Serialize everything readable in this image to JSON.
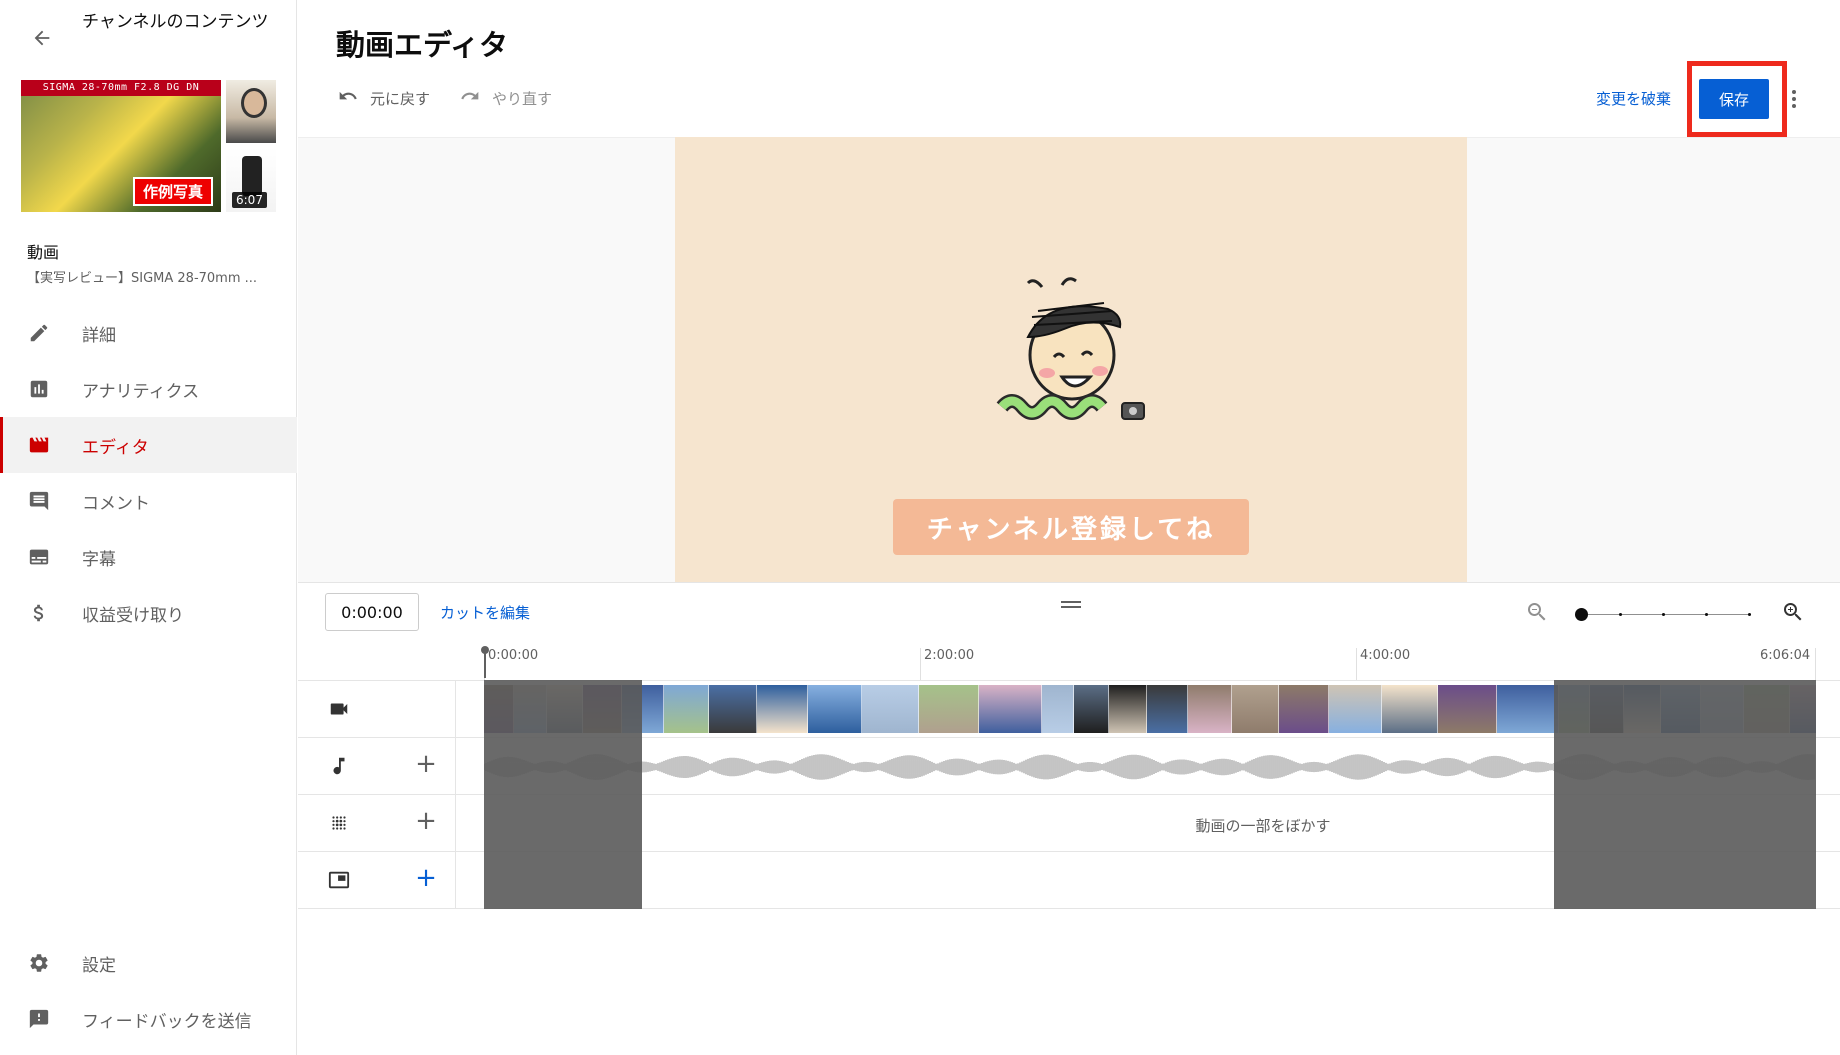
{
  "sidebar": {
    "back_label": "チャンネルのコンテンツ",
    "thumbnail": {
      "banner_text": "SIGMA 28-70mm F2.8 DG DN",
      "tag_text": "作例写真",
      "duration": "6:07"
    },
    "video_label": "動画",
    "video_title": "【実写レビュー】SIGMA 28-70mm ...",
    "nav_items": [
      {
        "label": "詳細",
        "icon": "pencil-icon"
      },
      {
        "label": "アナリティクス",
        "icon": "analytics-icon"
      },
      {
        "label": "エディタ",
        "icon": "clapperboard-icon",
        "active": true
      },
      {
        "label": "コメント",
        "icon": "comment-icon"
      },
      {
        "label": "字幕",
        "icon": "subtitles-icon"
      },
      {
        "label": "収益受け取り",
        "icon": "dollar-icon"
      }
    ],
    "bottom_items": [
      {
        "label": "設定",
        "icon": "gear-icon"
      },
      {
        "label": "フィードバックを送信",
        "icon": "feedback-icon"
      }
    ]
  },
  "header": {
    "title": "動画エディタ",
    "undo_label": "元に戻す",
    "redo_label": "やり直す",
    "discard_label": "変更を破棄",
    "save_label": "保存"
  },
  "preview": {
    "subscribe_text": "チャンネル登録してね"
  },
  "timeline": {
    "timecode": "0:00:00",
    "cut_edit_label": "カットを編集",
    "ticks": [
      "0:00:00",
      "2:00:00",
      "4:00:00",
      "6:06:04"
    ],
    "blur_label": "動画の一部をぼかす"
  },
  "colors": {
    "accent_blue": "#065fd4",
    "active_red": "#cc0000",
    "highlight_red": "#ee2a1d",
    "preview_bg": "#f6e5cf"
  }
}
